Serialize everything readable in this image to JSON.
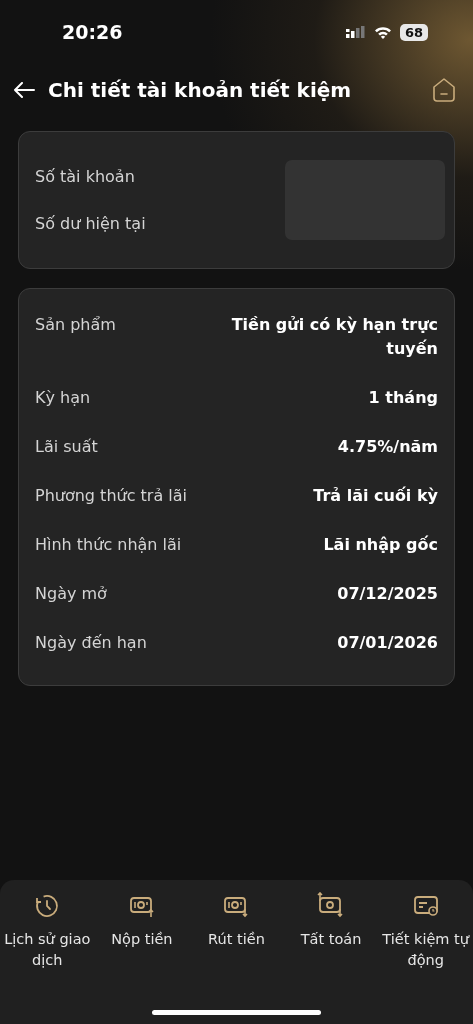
{
  "status_bar": {
    "time": "20:26",
    "battery": "68"
  },
  "header": {
    "title": "Chi tiết tài khoản tiết kiệm"
  },
  "account_card": {
    "rows": [
      {
        "label": "Số tài khoản"
      },
      {
        "label": "Số dư hiện tại"
      }
    ]
  },
  "details": [
    {
      "label": "Sản phẩm",
      "value": "Tiền gửi có kỳ hạn trực tuyến"
    },
    {
      "label": "Kỳ hạn",
      "value": "1 tháng"
    },
    {
      "label": "Lãi suất",
      "value": "4.75%/năm"
    },
    {
      "label": "Phương thức trả lãi",
      "value": "Trả lãi cuối kỳ"
    },
    {
      "label": "Hình thức nhận lãi",
      "value": "Lãi nhập gốc"
    },
    {
      "label": "Ngày mở",
      "value": "07/12/2025"
    },
    {
      "label": "Ngày đến hạn",
      "value": "07/01/2026"
    }
  ],
  "actions": [
    {
      "kind": "history",
      "label": "Lịch sử giao dịch"
    },
    {
      "kind": "deposit",
      "label": "Nộp tiền"
    },
    {
      "kind": "withdraw",
      "label": "Rút tiền"
    },
    {
      "kind": "settle",
      "label": "Tất toán"
    },
    {
      "kind": "auto",
      "label": "Tiết kiệm tự động"
    }
  ]
}
